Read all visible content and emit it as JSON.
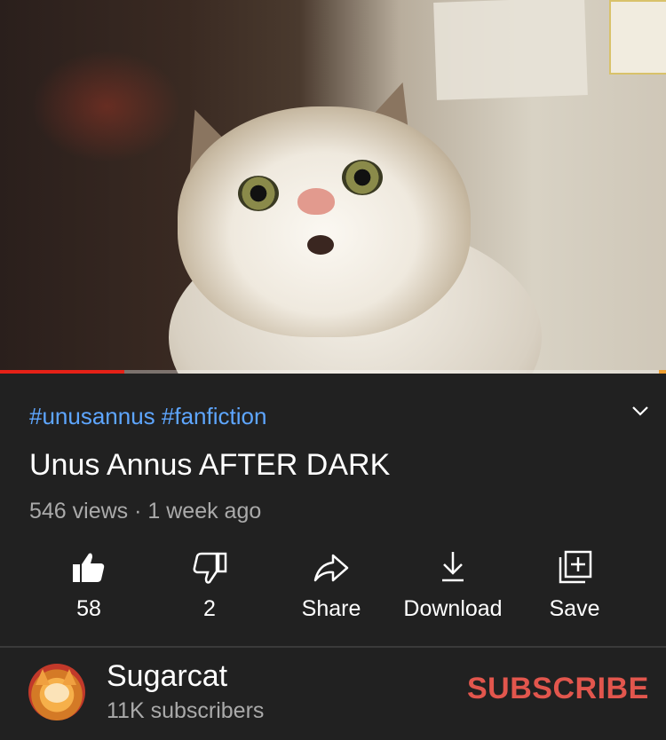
{
  "video": {
    "thumbnail_subject": "startled-cat",
    "progress_fraction": 0.187
  },
  "hashtags": "#unusannus #fanfiction",
  "title": "Unus Annus AFTER DARK",
  "meta": "546 views · 1 week ago",
  "actions": [
    {
      "icon": "thumbs-up-icon",
      "label": "58"
    },
    {
      "icon": "thumbs-down-icon",
      "label": "2"
    },
    {
      "icon": "share-icon",
      "label": "Share"
    },
    {
      "icon": "download-icon",
      "label": "Download"
    },
    {
      "icon": "save-icon",
      "label": "Save"
    }
  ],
  "channel": {
    "name": "Sugarcat",
    "subscribers": "11K subscribers",
    "subscribe_label": "SUBSCRIBE"
  },
  "colors": {
    "background": "#212121",
    "hashtag": "#5ea6ff",
    "subscribe": "#e2564d",
    "progress": "#e62117",
    "meta_text": "#aaaaaa"
  }
}
